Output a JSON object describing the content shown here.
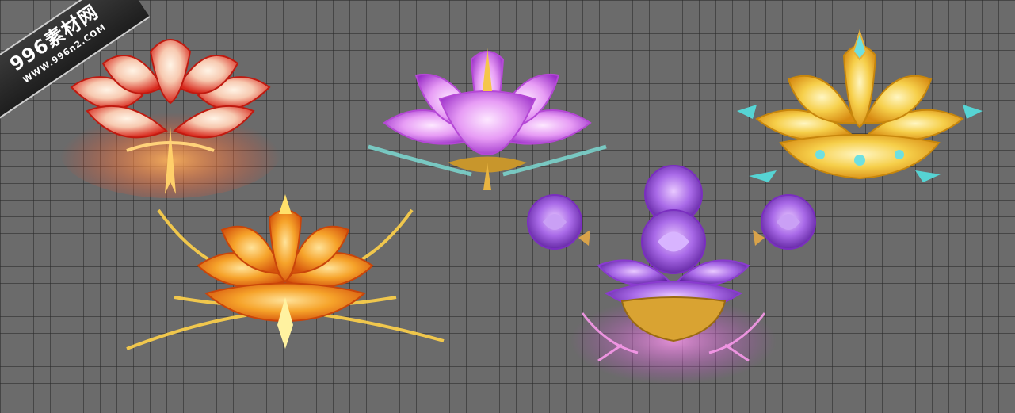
{
  "watermark": {
    "brand": "996素材网",
    "url": "WWW.996n2.COM"
  },
  "colors": {
    "grid_background": "#6b6b6b",
    "red_lotus": "#e03a2a",
    "violet_lotus": "#d27be8",
    "golden_lotus": "#f2c23a",
    "orange_lotus": "#f38a1c",
    "purple_rose_throne": "#9a5ad8"
  },
  "flowers": [
    {
      "name": "red-lotus-icon"
    },
    {
      "name": "violet-lotus-icon"
    },
    {
      "name": "golden-lotus-icon"
    },
    {
      "name": "orange-lotus-icon"
    },
    {
      "name": "purple-rose-throne-icon"
    }
  ]
}
